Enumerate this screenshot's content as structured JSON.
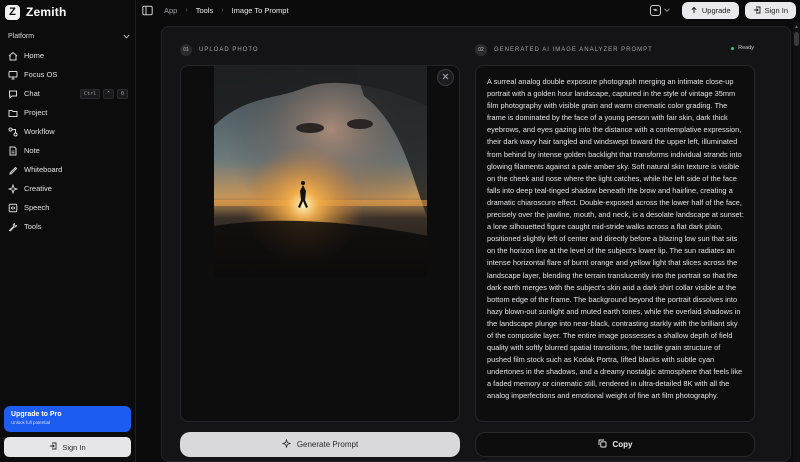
{
  "app": {
    "name": "Zemith",
    "logo_letter": "Z"
  },
  "sidebar": {
    "section": "Platform",
    "items": [
      {
        "label": "Home",
        "icon": "home-icon"
      },
      {
        "label": "Focus OS",
        "icon": "monitor-icon"
      },
      {
        "label": "Chat",
        "icon": "chat-icon",
        "shortcut": [
          "Ctrl",
          "^",
          "0"
        ]
      },
      {
        "label": "Project",
        "icon": "folder-icon"
      },
      {
        "label": "Workflow",
        "icon": "workflow-icon"
      },
      {
        "label": "Note",
        "icon": "note-icon"
      },
      {
        "label": "Whiteboard",
        "icon": "whiteboard-icon"
      },
      {
        "label": "Creative",
        "icon": "sparkle-icon"
      },
      {
        "label": "Speech",
        "icon": "speech-icon"
      },
      {
        "label": "Tools",
        "icon": "wrench-icon"
      }
    ],
    "upgrade": {
      "title": "Upgrade to Pro",
      "subtitle": "Unlock full potential"
    },
    "sign_in": "Sign In"
  },
  "topbar": {
    "breadcrumb": [
      "App",
      "Tools",
      "Image To Prompt"
    ],
    "upgrade": "Upgrade",
    "sign_in": "Sign In"
  },
  "upload": {
    "step": "01",
    "label": "UPLOAD PHOTO"
  },
  "output": {
    "step": "02",
    "label": "GENERATED AI IMAGE ANALYZER PROMPT",
    "status": "Ready",
    "prompt": "A surreal analog double exposure photograph merging an intimate close-up portrait with a golden hour landscape, captured in the style of vintage 35mm film photography with visible grain and warm cinematic color grading. The frame is dominated by the face of a young person with fair skin, dark thick eyebrows, and eyes gazing into the distance with a contemplative expression, their dark wavy hair tangled and windswept toward the upper left, illuminated from behind by intense golden backlight that transforms individual strands into glowing filaments against a pale amber sky. Soft natural skin texture is visible on the cheek and nose where the light catches, while the left side of the face falls into deep teal-tinged shadow beneath the brow and hairline, creating a dramatic chiaroscuro effect. Double-exposed across the lower half of the face, precisely over the jawline, mouth, and neck, is a desolate landscape at sunset: a lone silhouetted figure caught mid-stride walks across a flat dark plain, positioned slightly left of center and directly before a blazing low sun that sits on the horizon line at the level of the subject's lower lip. The sun radiates an intense horizontal flare of burnt orange and yellow light that slices across the landscape layer, blending the terrain translucently into the portrait so that the dark earth merges with the subject's skin and a dark shirt collar visible at the bottom edge of the frame. The background beyond the portrait dissolves into hazy blown-out sunlight and muted earth tones, while the overlaid shadows in the landscape plunge into near-black, contrasting starkly with the brilliant sky of the composite layer. The entire image possesses a shallow depth of field quality with softly blurred spatial transitions, the tactile grain structure of pushed film stock such as Kodak Portra, lifted blacks with subtle cyan undertones in the shadows, and a dreamy nostalgic atmosphere that feels like a faded memory or cinematic still, rendered in ultra-detailed 8K with all the analog imperfections and emotional weight of fine art film photography."
  },
  "actions": {
    "generate": "Generate Prompt",
    "copy": "Copy"
  },
  "colors": {
    "accent": "#1d5cf0",
    "status_ready": "#2ecc71",
    "background": "#0b0b0c"
  }
}
